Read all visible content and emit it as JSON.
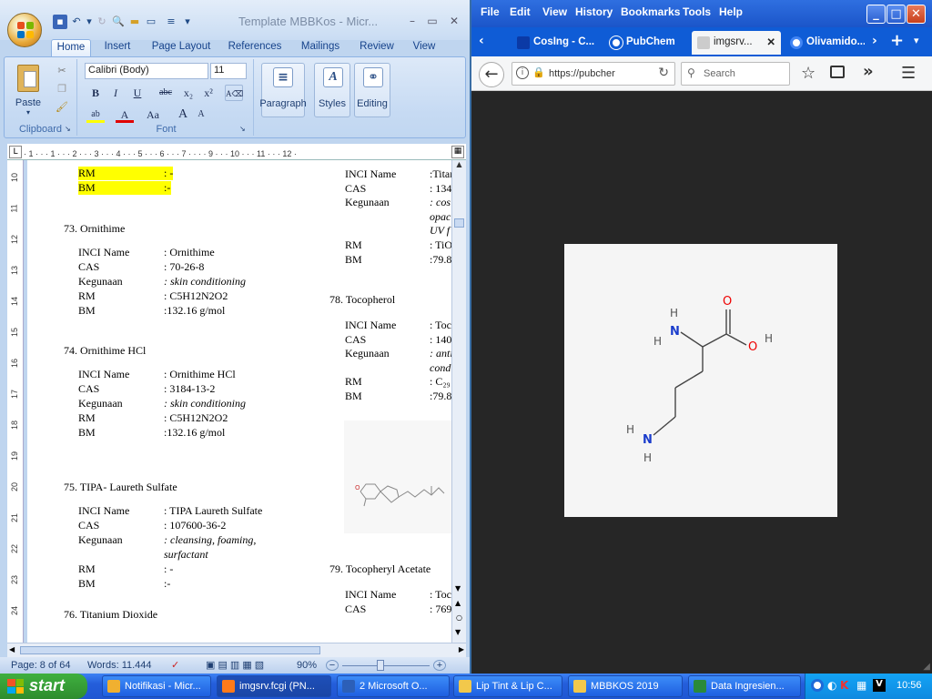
{
  "word": {
    "title": "Template MBBKos - Micr...",
    "tabs": [
      "Home",
      "Insert",
      "Page Layout",
      "References",
      "Mailings",
      "Review",
      "View"
    ],
    "clipboard": {
      "paste": "Paste",
      "label": "Clipboard"
    },
    "font": {
      "name": "Calibri (Body)",
      "size": "11",
      "label": "Font",
      "bold": "B",
      "italic": "I",
      "underline": "U",
      "strike": "abc",
      "sub": "x₂",
      "sup": "x²",
      "aa": "Aa",
      "grow": "A",
      "shrink": "A"
    },
    "paragraph": "Paragraph",
    "styles": "Styles",
    "editing": "Editing",
    "ruler_ticks": "· 1 · ·  · 1 · ·  · 2 · ·  · 3 · ·  · 4 · ·  · 5 · ·  · 6 · ·  · 7 · ·  ·     · 9 · ·  · 10 · ·  · 11 · ·  · 12 ·",
    "vruler": [
      "10",
      "11",
      "12",
      "13",
      "14",
      "15",
      "16",
      "17",
      "18",
      "19",
      "20",
      "21",
      "22",
      "23",
      "24"
    ],
    "left_column": {
      "top_rm_label": "RM",
      "top_rm_value": ": -",
      "top_bm_label": "BM",
      "top_bm_value": ":-",
      "sections": [
        {
          "title": "73. Ornithime",
          "rows": [
            [
              "INCI Name",
              ": Ornithime"
            ],
            [
              "CAS",
              ": 70-26-8"
            ],
            [
              "Kegunaan",
              ": skin conditioning"
            ],
            [
              "RM",
              ": C5H12N2O2"
            ],
            [
              "BM",
              ":132.16 g/mol"
            ]
          ]
        },
        {
          "title": "74. Ornithime HCl",
          "rows": [
            [
              "INCI Name",
              ": Ornithime HCl"
            ],
            [
              "CAS",
              ": 3184-13-2"
            ],
            [
              "Kegunaan",
              ": skin conditioning"
            ],
            [
              "RM",
              ": C5H12N2O2"
            ],
            [
              "BM",
              ":132.16 g/mol"
            ]
          ]
        },
        {
          "title": "75. TIPA- Laureth Sulfate",
          "rows": [
            [
              "INCI Name",
              ": TIPA Laureth Sulfate"
            ],
            [
              "CAS",
              ": 107600-36-2"
            ],
            [
              "Kegunaan",
              ": cleansing, foaming,"
            ],
            [
              "",
              "surfactant"
            ],
            [
              "RM",
              ": -"
            ],
            [
              "BM",
              ":-"
            ]
          ]
        },
        {
          "title": "76. Titanium Dioxide",
          "rows": []
        }
      ]
    },
    "right_column": {
      "r1": [
        [
          "INCI Name",
          ":Titan"
        ],
        [
          "CAS",
          ": 134"
        ],
        [
          "Kegunaan",
          ": cos"
        ],
        [
          "",
          "opac"
        ],
        [
          "",
          "UV f"
        ],
        [
          "RM",
          ": TiO"
        ],
        [
          "BM",
          ":79.8"
        ]
      ],
      "sec78": "78. Tocopherol",
      "r2": [
        [
          "INCI Name",
          ": Toc"
        ],
        [
          "CAS",
          ": 140"
        ],
        [
          "Kegunaan",
          ": anti"
        ],
        [
          "",
          "cond"
        ],
        [
          "RM",
          ": C₂₉"
        ],
        [
          "BM",
          ":79.8"
        ]
      ],
      "sec79": "79. Tocopheryl Acetate",
      "r3": [
        [
          "INCI Name",
          ": Toc"
        ],
        [
          "CAS",
          ": 769"
        ]
      ]
    },
    "status": {
      "page": "Page: 8 of 64",
      "words": "Words: 11.444",
      "zoom": "90%"
    }
  },
  "firefox": {
    "menu": [
      "File",
      "Edit",
      "View",
      "History",
      "Bookmarks",
      "Tools",
      "Help"
    ],
    "tabs": [
      {
        "label": "CosIng - C...",
        "icon_color": "#0b3aa6"
      },
      {
        "label": "PubChem",
        "icon_color": "#ffffff"
      },
      {
        "label": "imgsrv...",
        "icon_color": "#cccccc"
      },
      {
        "label": "Olivamido...",
        "icon_color": "#ffffff"
      }
    ],
    "url": "https://pubcher",
    "search_placeholder": "Search",
    "molecule": {
      "atoms": [
        "H",
        "N",
        "H",
        "O",
        "O",
        "H",
        "H",
        "N",
        "H"
      ]
    }
  },
  "taskbar": {
    "start": "start",
    "items": [
      {
        "label": "Notifikasi - Micr...",
        "color": "#f0b030"
      },
      {
        "label": "imgsrv.fcgi (PN...",
        "color": "#ff7a1a"
      },
      {
        "label": "2 Microsoft O...",
        "color": "#2c5fb8"
      },
      {
        "label": "Lip Tint & Lip C...",
        "color": "#f2c84b"
      },
      {
        "label": "MBBKOS 2019",
        "color": "#f2c84b"
      },
      {
        "label": "Data Ingresien...",
        "color": "#2a8a3a"
      }
    ],
    "clock": "10:56"
  }
}
